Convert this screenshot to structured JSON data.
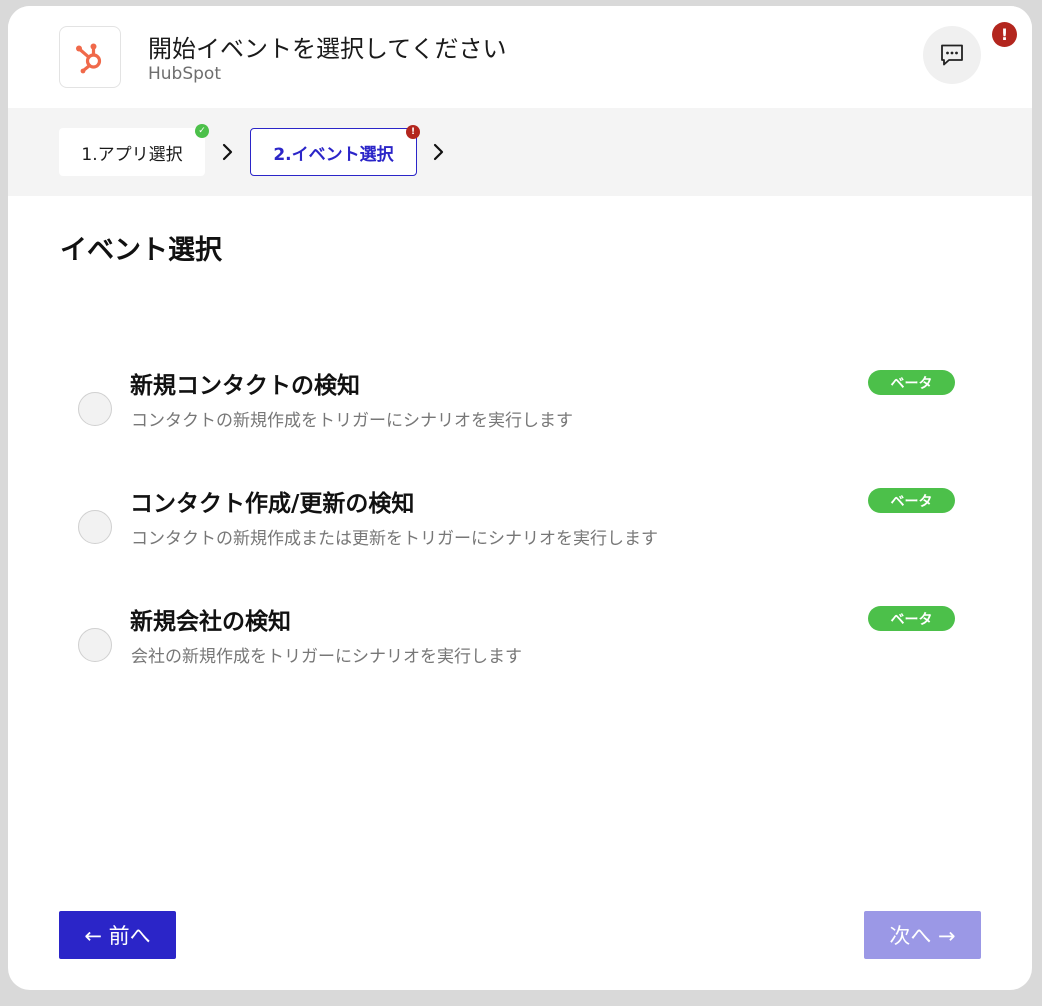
{
  "header": {
    "title": "開始イベントを選択してください",
    "app_name": "HubSpot",
    "alert_glyph": "!",
    "logo_icon": "hubspot-sprocket-icon",
    "chat_icon": "chat-bubble-icon",
    "brand_color": "#f0694a"
  },
  "stepper": {
    "steps": [
      {
        "label": "1.アプリ選択",
        "status": "complete",
        "status_glyph": "✓"
      },
      {
        "label": "2.イベント選択",
        "status": "error",
        "status_glyph": "!"
      }
    ]
  },
  "main": {
    "section_title": "イベント選択",
    "events": [
      {
        "title": "新規コンタクトの検知",
        "description": "コンタクトの新規作成をトリガーにシナリオを実行します",
        "badge": "ベータ",
        "selected": false
      },
      {
        "title": "コンタクト作成/更新の検知",
        "description": "コンタクトの新規作成または更新をトリガーにシナリオを実行します",
        "badge": "ベータ",
        "selected": false
      },
      {
        "title": "新規会社の検知",
        "description": "会社の新規作成をトリガーにシナリオを実行します",
        "badge": "ベータ",
        "selected": false
      }
    ]
  },
  "footer": {
    "prev_label": "← 前へ",
    "next_label": "次へ →"
  },
  "colors": {
    "accent": "#2b25c8",
    "accent_disabled": "#9b98e6",
    "success": "#4cc04a",
    "error": "#b3261e"
  }
}
